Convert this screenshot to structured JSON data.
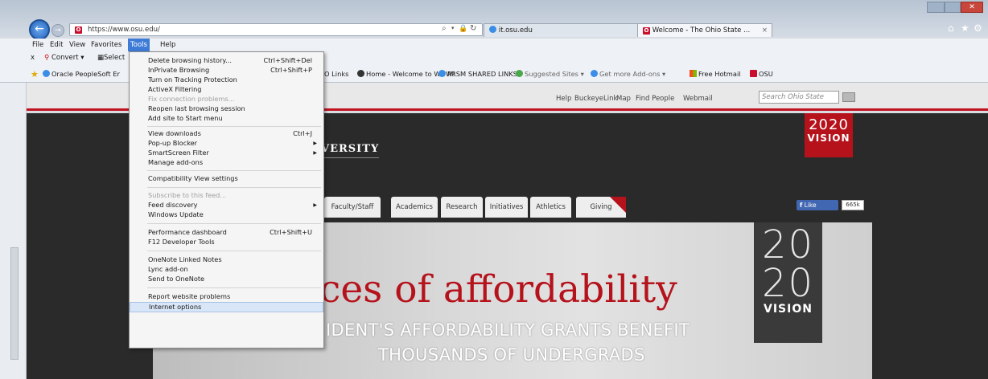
{
  "browser": {
    "url": "https://www.osu.edu/",
    "search_tab_label": "it.osu.edu",
    "active_tab_label": "Welcome - The Ohio State ...",
    "tab_close": "×"
  },
  "menubar": [
    "File",
    "Edit",
    "View",
    "Favorites",
    "Tools",
    "Help"
  ],
  "command_bar": {
    "convert": "Convert",
    "select": "Select"
  },
  "favorites": [
    "Oracle PeopleSoft Er",
    "O Links",
    "Home - Welcome to WOW!",
    "PRSM SHARED LINKS",
    "Suggested Sites",
    "Get more Add-ons",
    "Free Hotmail",
    "OSU"
  ],
  "tools_menu": {
    "items": [
      {
        "label": "Delete browsing history...",
        "shortcut": "Ctrl+Shift+Del"
      },
      {
        "label": "InPrivate Browsing",
        "shortcut": "Ctrl+Shift+P"
      },
      {
        "label": "Turn on Tracking Protection"
      },
      {
        "label": "ActiveX Filtering"
      },
      {
        "label": "Fix connection problems...",
        "disabled": true
      },
      {
        "label": "Reopen last browsing session"
      },
      {
        "label": "Add site to Start menu"
      },
      {
        "label": "View downloads",
        "shortcut": "Ctrl+J"
      },
      {
        "label": "Pop-up Blocker",
        "submenu": true
      },
      {
        "label": "SmartScreen Filter",
        "submenu": true
      },
      {
        "label": "Manage add-ons"
      },
      {
        "label": "Compatibility View settings"
      },
      {
        "label": "Subscribe to this feed...",
        "disabled": true
      },
      {
        "label": "Feed discovery",
        "submenu": true
      },
      {
        "label": "Windows Update"
      },
      {
        "label": "Performance dashboard",
        "shortcut": "Ctrl+Shift+U"
      },
      {
        "label": "F12 Developer Tools"
      },
      {
        "label": "OneNote Linked Notes"
      },
      {
        "label": "Lync add-on"
      },
      {
        "label": "Send to OneNote"
      },
      {
        "label": "Report website problems"
      },
      {
        "label": "Internet options",
        "highlighted": true
      }
    ]
  },
  "site": {
    "utility_links": [
      "Help",
      "BuckeyeLink",
      "Map",
      "Find People",
      "Webmail"
    ],
    "search_placeholder": "Search Ohio State",
    "university_partial": "VERSITY",
    "vision_year": "2020",
    "vision_word": "VISION",
    "nav_tabs": [
      "Faculty/Staff",
      "Academics",
      "Research",
      "Initiatives",
      "Athletics",
      "Giving"
    ],
    "like_label": "Like",
    "like_count": "665k",
    "headline": "ces of affordability",
    "subhead_line1": "IDENT'S AFFORDABILITY GRANTS BENEFIT",
    "subhead_line2": "THOUSANDS OF UNDERGRADS",
    "big_20_top": "20",
    "big_20_bottom": "20",
    "big_vision": "VISION"
  },
  "colors": {
    "osu_scarlet": "#b5121b",
    "menu_highlight": "#3d7bd6"
  }
}
